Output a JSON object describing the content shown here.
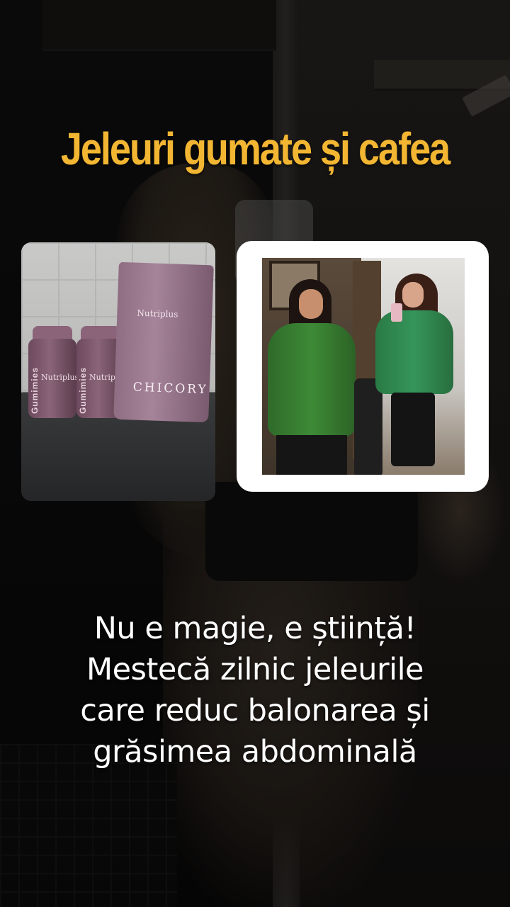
{
  "headline": "Jeleuri gumate și cafea",
  "products_image": {
    "jar_brand": "Nutriplus",
    "jar_side_text": "Gumimies",
    "pouch_brand": "Nutriplus",
    "pouch_name": "CHICORY"
  },
  "body_lines": [
    "Nu e magie, e știință!",
    "Mestecă zilnic jeleurile",
    "care reduc balonarea și",
    "grăsimea abdominală"
  ],
  "colors": {
    "headline": "#f2b632",
    "body_text": "#ffffff",
    "card_border": "#ffffff"
  }
}
